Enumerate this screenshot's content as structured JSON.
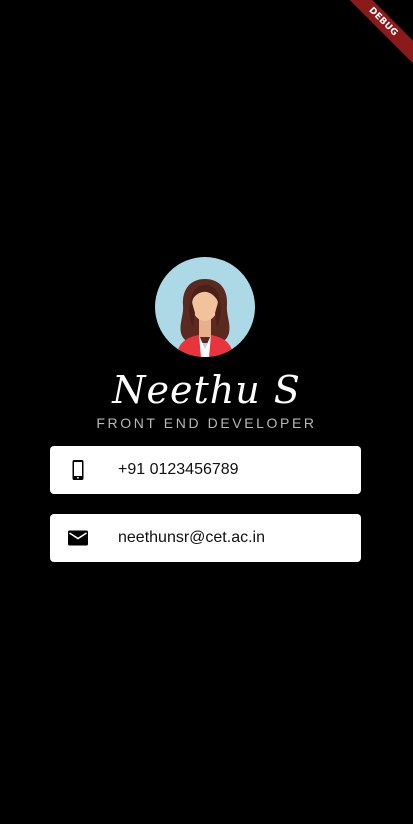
{
  "debug_banner": {
    "label": "DEBUG",
    "color": "#8b1a1a"
  },
  "profile": {
    "avatar_icon": "female-avatar-icon",
    "avatar_background": "#add8e6",
    "name": "Neethu S",
    "title": "FRONT END DEVELOPER"
  },
  "contacts": {
    "phone": {
      "icon": "smartphone-icon",
      "value": "+91 0123456789"
    },
    "email": {
      "icon": "mail-icon",
      "value": "neethunsr@cet.ac.in"
    }
  },
  "colors": {
    "background": "#000000",
    "card": "#ffffff",
    "title_text": "#b8b8b8"
  }
}
